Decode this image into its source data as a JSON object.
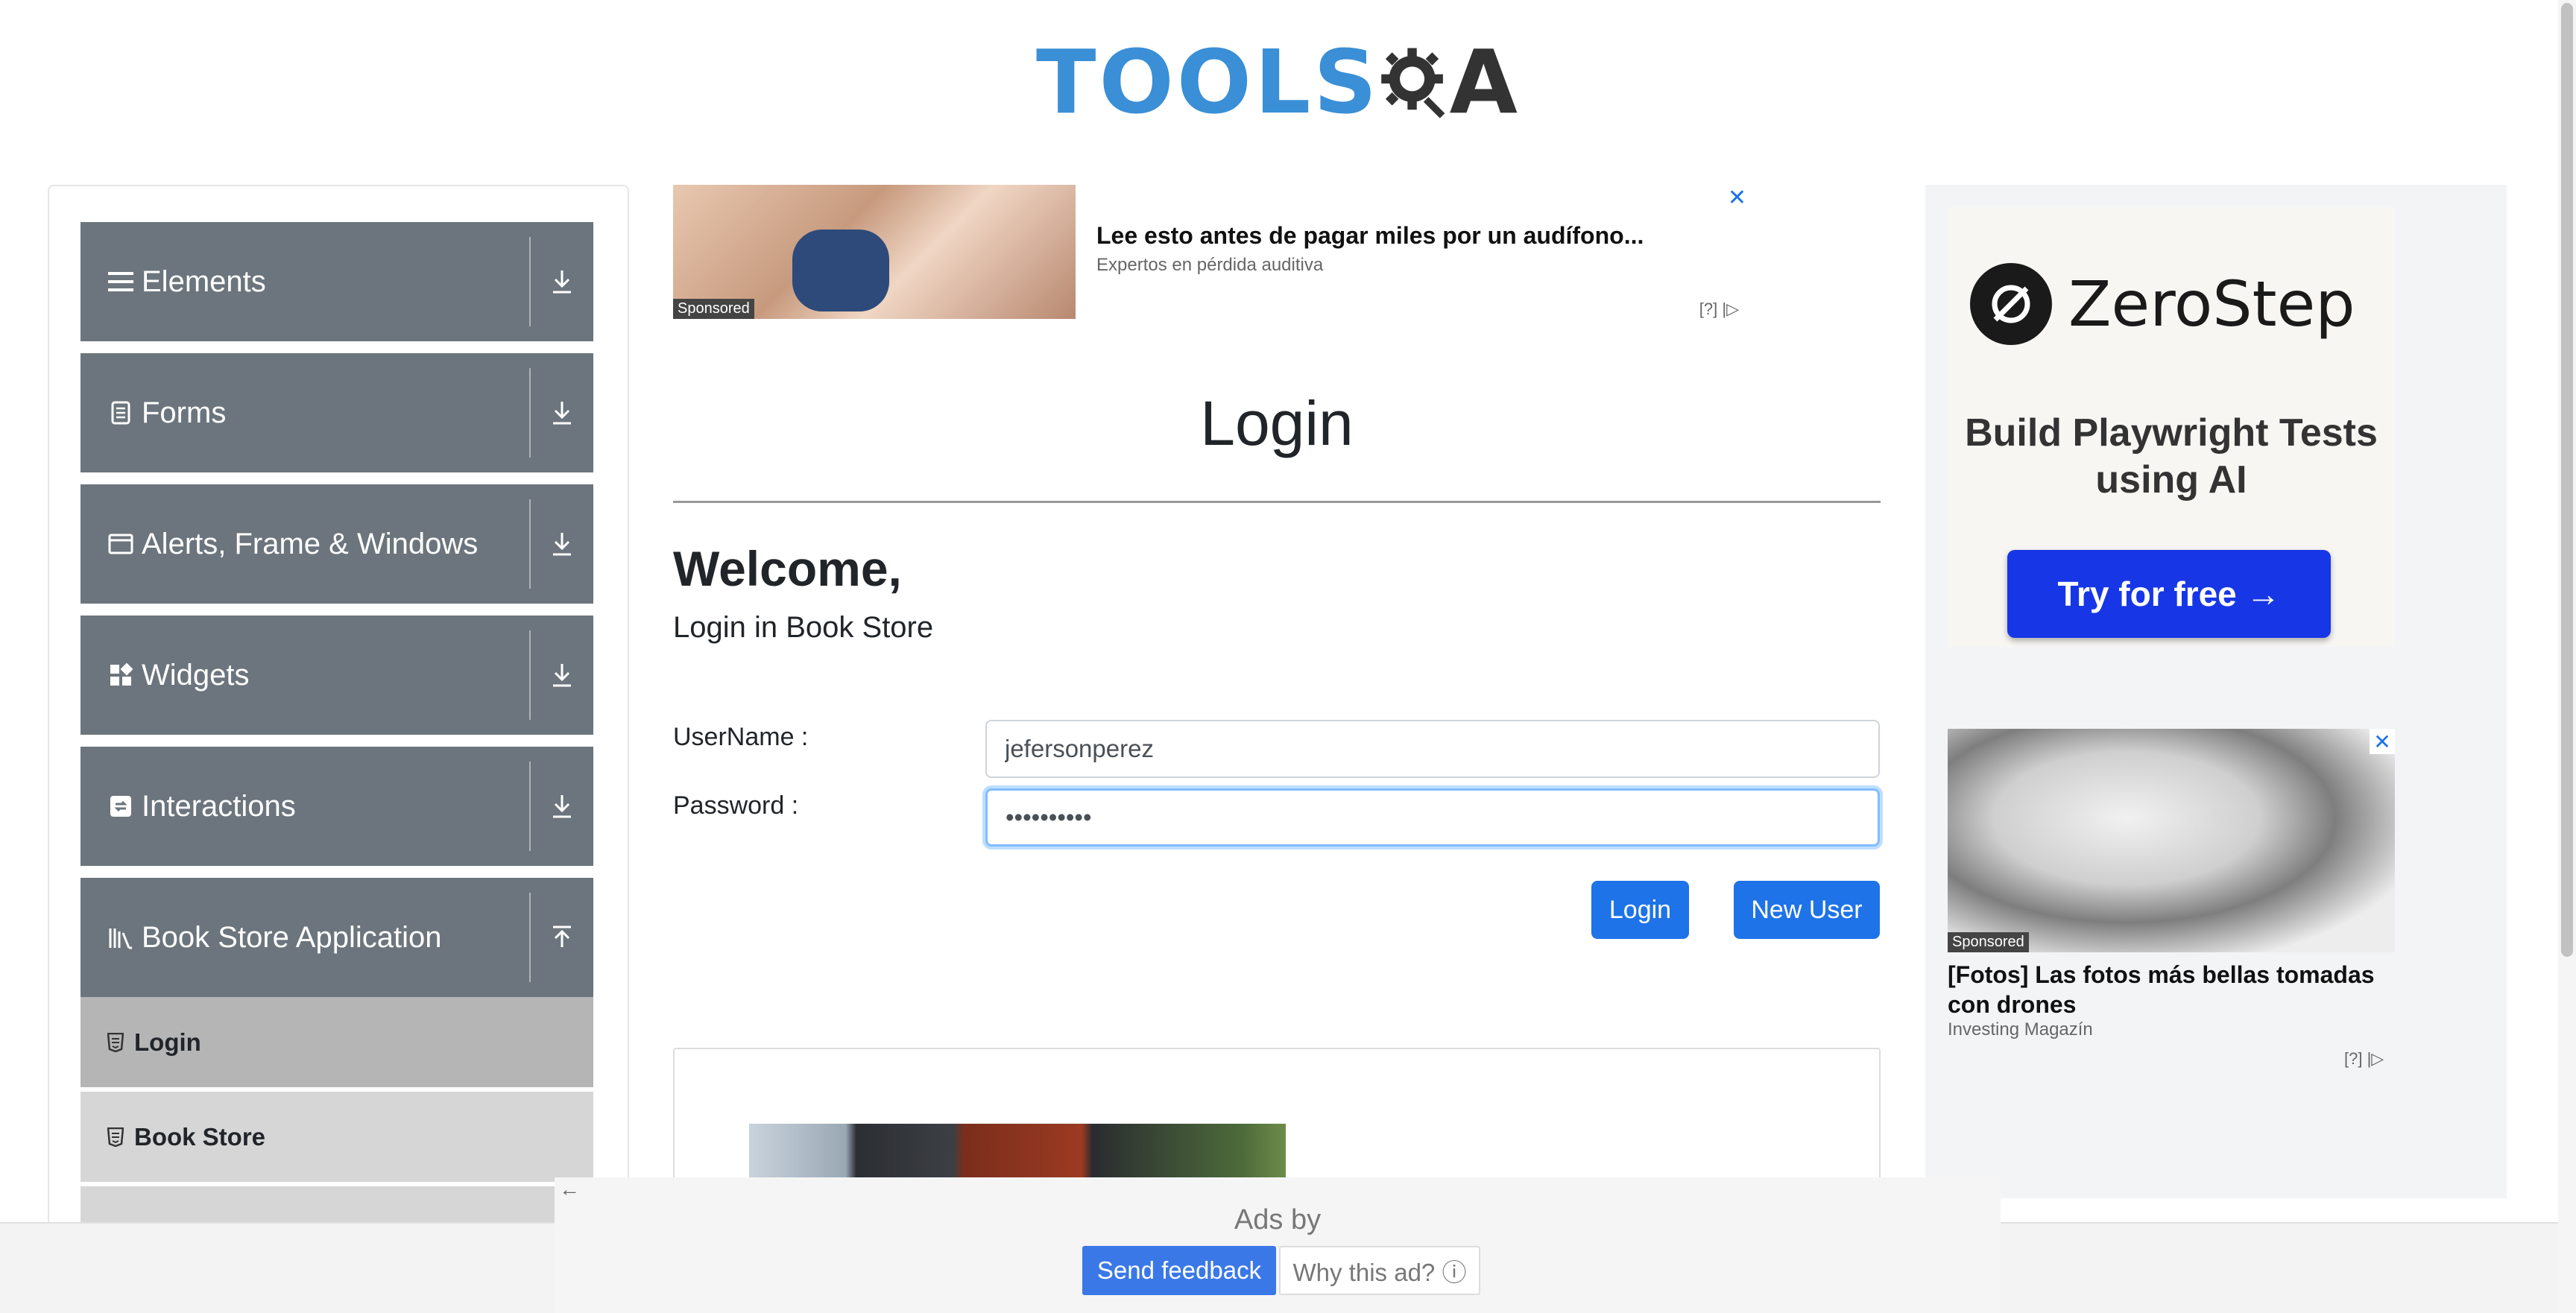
{
  "header": {
    "logo_tools": "TOOLS",
    "logo_qa": "A",
    "logo_alt": "TOOLSQA"
  },
  "sidebar": {
    "groups": [
      {
        "label": "Elements",
        "icon": "hamburger-icon",
        "toggle": "download-icon"
      },
      {
        "label": "Forms",
        "icon": "document-icon",
        "toggle": "download-icon"
      },
      {
        "label": "Alerts, Frame & Windows",
        "icon": "window-icon",
        "toggle": "download-icon"
      },
      {
        "label": "Widgets",
        "icon": "widgets-icon",
        "toggle": "download-icon"
      },
      {
        "label": "Interactions",
        "icon": "interactions-icon",
        "toggle": "download-icon"
      },
      {
        "label": "Book Store Application",
        "icon": "library-icon",
        "toggle": "upload-icon"
      }
    ],
    "sub_items": [
      {
        "label": "Login",
        "active": true
      },
      {
        "label": "Book Store",
        "active": false
      }
    ]
  },
  "ad_top": {
    "badge": "Sponsored",
    "title": "Lee esto antes de pagar miles por un audífono...",
    "source": "Expertos en pérdida auditiva",
    "info": "[?]"
  },
  "main": {
    "title": "Login",
    "welcome": "Welcome,",
    "subtitle": "Login in Book Store",
    "username_label": "UserName :",
    "username_value": "jefersonperez",
    "password_label": "Password :",
    "password_value": "••••••••••",
    "login_button": "Login",
    "new_user_button": "New User"
  },
  "ad_right": {
    "brand": "ZeroStep",
    "tagline": "Build Playwright Tests using AI",
    "cta": "Try for free →",
    "badge": "Sponsored",
    "ad2_title": "[Fotos] Las fotos más bellas tomadas con drones",
    "ad2_source": "Investing Magazín",
    "ad2_info": "[?]"
  },
  "ads_bar": {
    "ads_by": "Ads by",
    "send_feedback": "Send feedback",
    "why_this_ad": "Why this ad? ⓘ"
  },
  "colors": {
    "primary": "#1e73e8",
    "sidebar_group": "#6c757d",
    "logo_blue": "#3a8fd6"
  }
}
